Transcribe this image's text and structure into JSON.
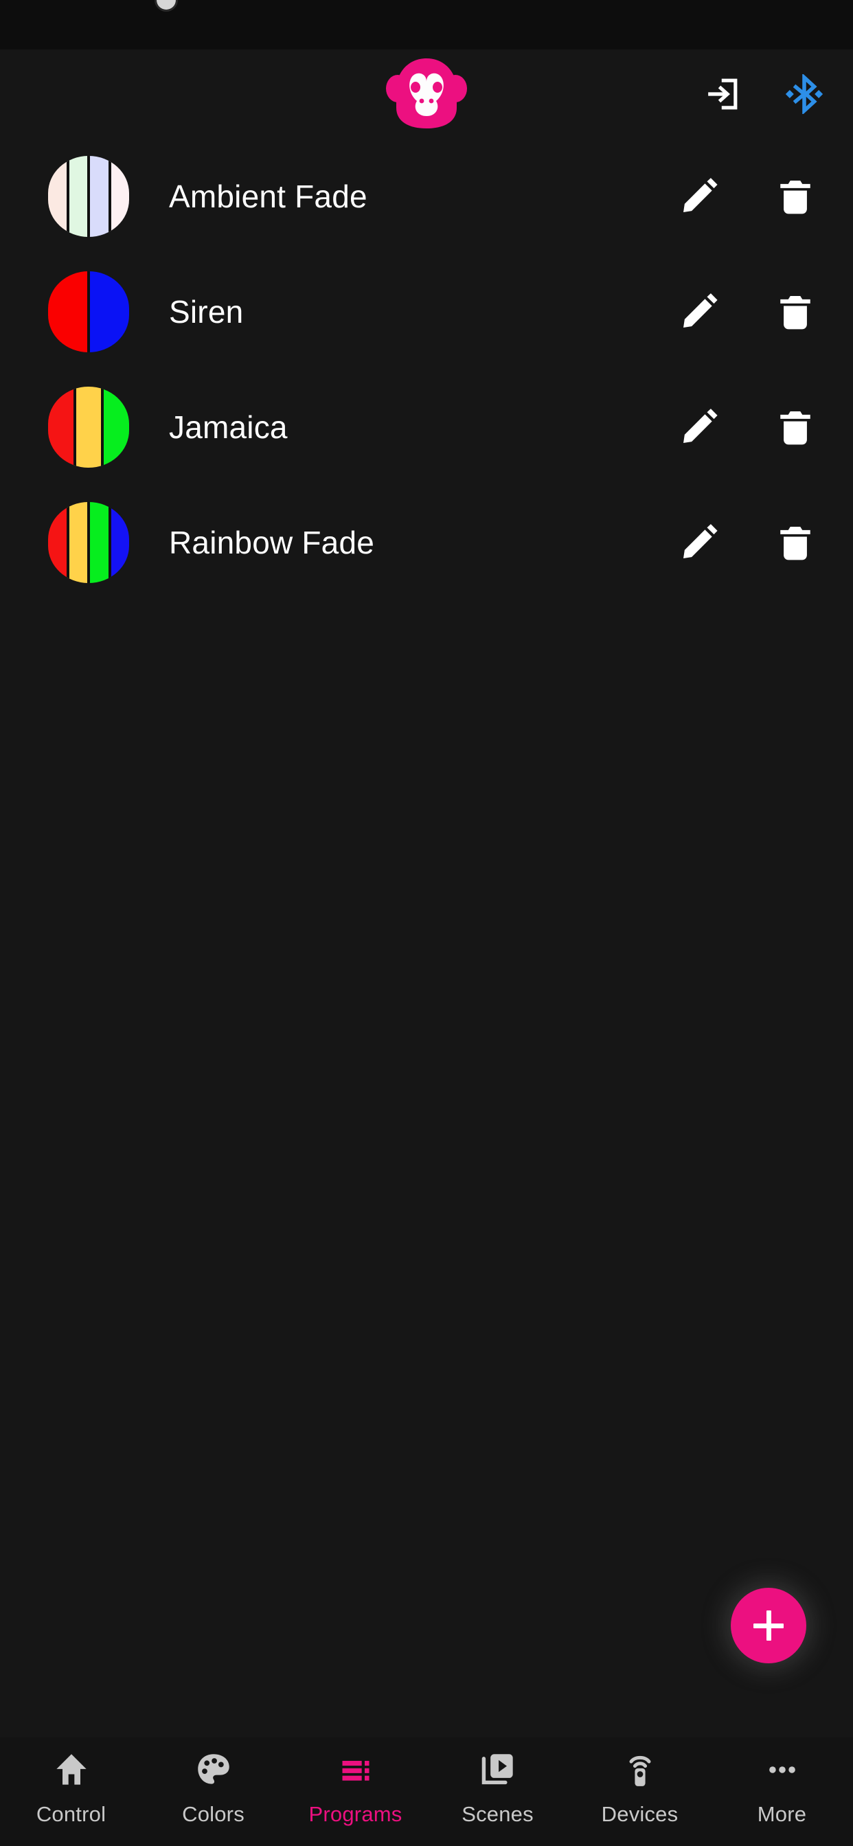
{
  "app": {
    "theme_bg": "#161616",
    "accent": "#ec1080",
    "bluetooth_color": "#2d8fe8",
    "logo_name": "monkey-logo"
  },
  "header": {
    "login_icon": "login-icon",
    "login_label": "Sign in",
    "bluetooth_icon": "bluetooth-icon",
    "bluetooth_label": "Bluetooth"
  },
  "programs": [
    {
      "name": "Ambient Fade",
      "colors": [
        "#fbe9e2",
        "#e0f7e2",
        "#d9dcfb",
        "#fdf1f3"
      ],
      "edit_label": "Edit",
      "delete_label": "Delete"
    },
    {
      "name": "Siren",
      "colors": [
        "#fa0000",
        "#0a12f5"
      ],
      "edit_label": "Edit",
      "delete_label": "Delete"
    },
    {
      "name": "Jamaica",
      "colors": [
        "#f51414",
        "#ffd24a",
        "#06ee1e"
      ],
      "edit_label": "Edit",
      "delete_label": "Delete"
    },
    {
      "name": "Rainbow Fade",
      "colors": [
        "#f51414",
        "#ffd24a",
        "#06ee1e",
        "#1412f5"
      ],
      "edit_label": "Edit",
      "delete_label": "Delete"
    }
  ],
  "fab": {
    "label": "+",
    "name": "add-program-button",
    "color": "#ec1080"
  },
  "bottom_nav": {
    "active": "Programs",
    "items": [
      {
        "label": "Control",
        "icon": "home-icon"
      },
      {
        "label": "Colors",
        "icon": "palette-icon"
      },
      {
        "label": "Programs",
        "icon": "list-lines-icon"
      },
      {
        "label": "Scenes",
        "icon": "scenes-play-icon"
      },
      {
        "label": "Devices",
        "icon": "remote-signal-icon"
      },
      {
        "label": "More",
        "icon": "more-dots-icon"
      }
    ]
  }
}
